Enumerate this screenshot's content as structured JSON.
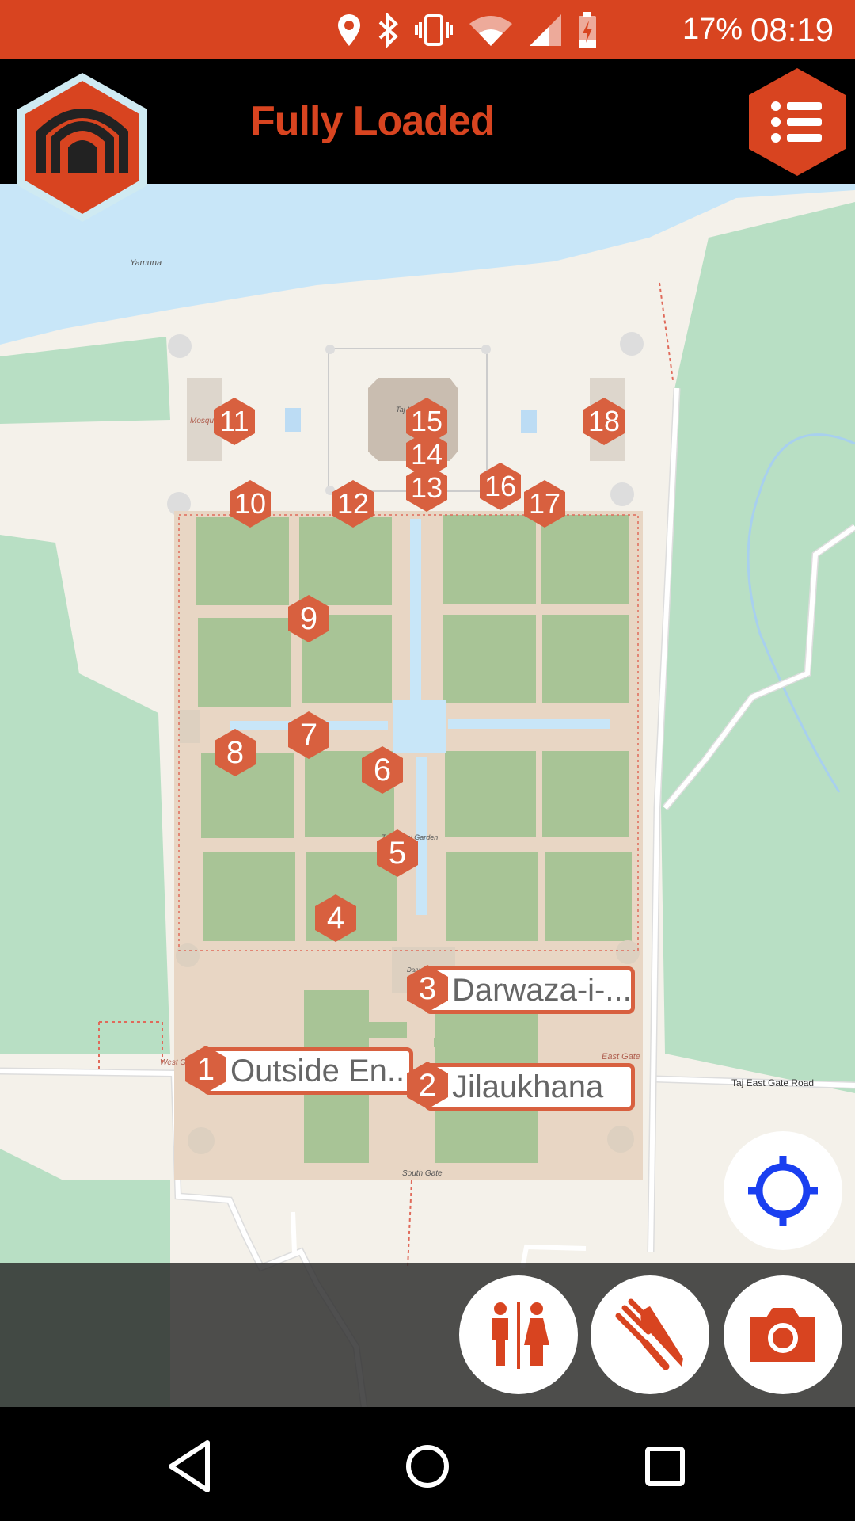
{
  "status_bar": {
    "battery": "17%",
    "time": "08:19",
    "icons": [
      "location-icon",
      "bluetooth-icon",
      "vibrate-icon",
      "wifi-icon",
      "signal-icon",
      "battery-charging-icon"
    ]
  },
  "app_bar": {
    "title": "Fully Loaded",
    "logo": "gate-logo-icon",
    "menu": "menu-list-icon"
  },
  "colors": {
    "accent": "#d84420",
    "marker": "#d8603f",
    "water": "#c8e6f8",
    "park": "#b8dfc4",
    "garden": "#a8c496",
    "plaza": "#e8d6c4",
    "locate": "#1a3ff0"
  },
  "map_labels": {
    "river": "Yamuna",
    "mosque": "Mosque",
    "taj": "Taj Mahal",
    "garden": "Taj Mahal Garden",
    "darwaza": "Darwaza-i-Rauza",
    "west_gate": "West Gate",
    "east_gate": "East Gate",
    "south_gate": "South Gate",
    "road": "Taj East Gate Road"
  },
  "markers": [
    "4",
    "5",
    "6",
    "7",
    "8",
    "9",
    "10",
    "11",
    "12",
    "13",
    "14",
    "15",
    "16",
    "17",
    "18"
  ],
  "callouts": [
    {
      "number": "1",
      "label": "Outside En..."
    },
    {
      "number": "2",
      "label": "Jilaukhana"
    },
    {
      "number": "3",
      "label": "Darwaza-i-..."
    }
  ],
  "action_buttons": [
    "restroom-icon",
    "restaurant-icon",
    "camera-icon"
  ],
  "locate_button": "crosshair-locate-icon",
  "nav_bar": [
    "back-icon",
    "home-icon",
    "recents-icon"
  ]
}
